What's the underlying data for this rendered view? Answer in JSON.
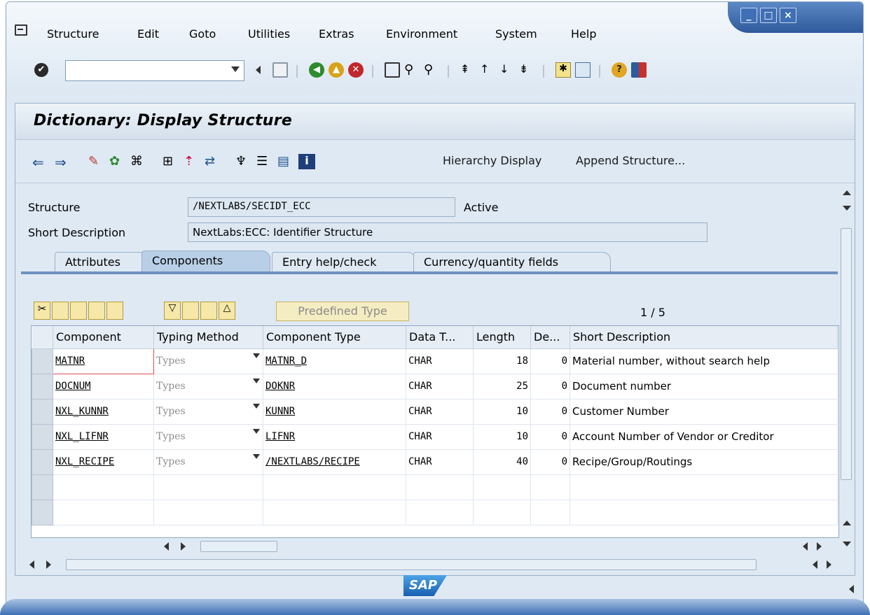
{
  "menu": [
    "Structure",
    "Edit",
    "Goto",
    "Utilities",
    "Extras",
    "Environment",
    "System",
    "Help"
  ],
  "title": "Dictionary: Display Structure",
  "app_toolbar": {
    "hierarchy_display": "Hierarchy Display",
    "append_structure": "Append Structure..."
  },
  "fields": {
    "structure_label": "Structure",
    "structure_value": "/NEXTLABS/SECIDT_ECC",
    "status": "Active",
    "short_desc_label": "Short Description",
    "short_desc_value": "NextLabs:ECC: Identifier Structure"
  },
  "tabs": [
    "Attributes",
    "Components",
    "Entry help/check",
    "Currency/quantity fields"
  ],
  "grid": {
    "predefined_type": "Predefined Type",
    "pager": "1 / 5",
    "headers": [
      "Component",
      "Typing Method",
      "Component Type",
      "Data T...",
      "Length",
      "De...",
      "Short Description"
    ],
    "rows": [
      {
        "component": "MATNR",
        "typing": "Types",
        "comp_type": "MATNR_D",
        "data_type": "CHAR",
        "length": "18",
        "dec": "0",
        "desc": "Material number, without search help"
      },
      {
        "component": "DOCNUM",
        "typing": "Types",
        "comp_type": "DOKNR",
        "data_type": "CHAR",
        "length": "25",
        "dec": "0",
        "desc": "Document number"
      },
      {
        "component": "NXL_KUNNR",
        "typing": "Types",
        "comp_type": "KUNNR",
        "data_type": "CHAR",
        "length": "10",
        "dec": "0",
        "desc": "Customer Number"
      },
      {
        "component": "NXL_LIFNR",
        "typing": "Types",
        "comp_type": "LIFNR",
        "data_type": "CHAR",
        "length": "10",
        "dec": "0",
        "desc": "Account Number of Vendor or Creditor"
      },
      {
        "component": "NXL_RECIPE",
        "typing": "Types",
        "comp_type": "/NEXTLABS/RECIPE",
        "data_type": "CHAR",
        "length": "40",
        "dec": "0",
        "desc": "Recipe/Group/Routings"
      }
    ]
  },
  "footer": {
    "logo": "SAP"
  },
  "colors": {
    "accent": "#3f6fb5",
    "tab_active": "#b8cfe7",
    "background": "#dfe9f3"
  }
}
